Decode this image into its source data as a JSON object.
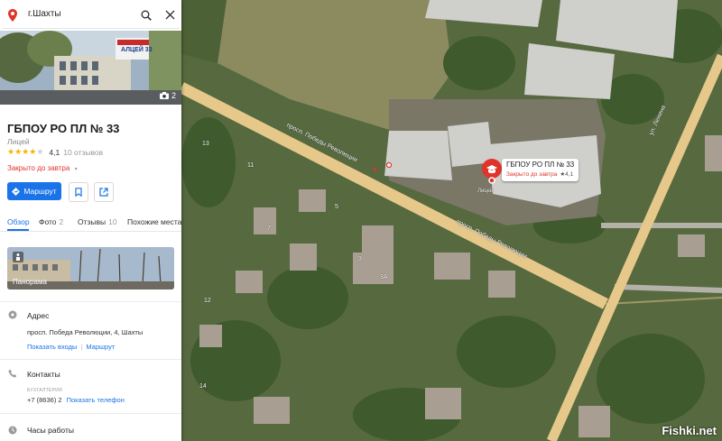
{
  "search": {
    "value": "г.Шахты"
  },
  "photo": {
    "count": "2",
    "sign": "АЛЦЕЙ 33"
  },
  "place": {
    "title": "ГБПОУ РО ПЛ № 33",
    "category": "Лицей",
    "rating_stars": 4,
    "rating": "4,1",
    "reviews": "10 отзывов",
    "status": "Закрыто до завтра"
  },
  "actions": {
    "route_label": "Маршрут"
  },
  "tabs": [
    {
      "label": "Обзор",
      "count": ""
    },
    {
      "label": "Фото",
      "count": "2"
    },
    {
      "label": "Отзывы",
      "count": "10"
    },
    {
      "label": "Похожие места",
      "count": ""
    }
  ],
  "panorama": {
    "label": "Панорама"
  },
  "address": {
    "heading": "Адрес",
    "value": "просп. Победа Революции, 4, Шахты",
    "show_entrances": "Показать входы",
    "route": "Маршрут"
  },
  "contacts": {
    "heading": "Контакты",
    "phone_label": "БУХГАЛТЕРИЯ",
    "phone": "+7 (8636) 2",
    "show_phone": "Показать телефон"
  },
  "hours": {
    "heading": "Часы работы"
  },
  "map": {
    "marker_title": "ГБПОУ РО ПЛ № 33",
    "marker_status": "Закрыто до завтра",
    "marker_rating": "★4,1",
    "marker_sub": "Лицей",
    "street1": "просп. Победы Революции",
    "street2": "ул. Ленина",
    "building_numbers": [
      "13",
      "11",
      "7",
      "5",
      "3",
      "3А",
      "12",
      "14"
    ]
  },
  "watermark": "Fishki.net",
  "colors": {
    "accent": "#1a73e8",
    "closed": "#e0342b",
    "star": "#f5b400",
    "road": "#e6c88a"
  }
}
